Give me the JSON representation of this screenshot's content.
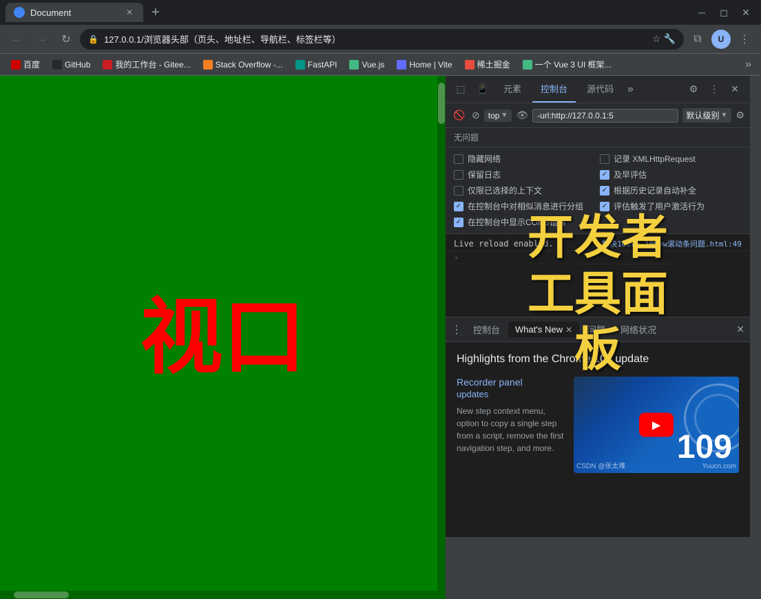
{
  "browser": {
    "tab": {
      "title": "Document",
      "favicon": "D"
    },
    "address": "127.0.0.1/浏览器头部（页头、地址栏、导航栏、标签栏等）",
    "title_annotation": "浏览器头部（页头、地址栏、导航栏、标签栏等）"
  },
  "bookmarks": [
    {
      "label": "百度",
      "icon": "bm-baidu"
    },
    {
      "label": "GitHub",
      "icon": "bm-github"
    },
    {
      "label": "我的工作台 - Gitee...",
      "icon": "bm-gitee"
    },
    {
      "label": "Stack Overflow -...",
      "icon": "bm-so"
    },
    {
      "label": "FastAPI",
      "icon": "bm-fastapi"
    },
    {
      "label": "Vue.js",
      "icon": "bm-vue"
    },
    {
      "label": "Home | Vite",
      "icon": "bm-vite"
    },
    {
      "label": "稀土掘金",
      "icon": "bm-siji"
    },
    {
      "label": "一个 Vue 3 UI 框架...",
      "icon": "bm-vue3"
    }
  ],
  "webpage": {
    "main_text": "视口"
  },
  "devtools": {
    "tabs": [
      "元素",
      "控制台",
      "源代码"
    ],
    "active_tab": "控制台",
    "context": "top",
    "filter_placeholder": "-url:http://127.0.0.1:5",
    "level": "默认级别",
    "issues_text": "无问题",
    "checkboxes": [
      {
        "label": "隐藏网络",
        "checked": false
      },
      {
        "label": "记录 XMLHttpRequest",
        "checked": false
      },
      {
        "label": "保留日志",
        "checked": false
      },
      {
        "label": "及早评估",
        "checked": true
      },
      {
        "label": "仅限已选择的上下文",
        "checked": false
      },
      {
        "label": "根据历史记录自动补全",
        "checked": true
      },
      {
        "label": "在控制台中对相似消息进行分组",
        "checked": true
      },
      {
        "label": "评估触发了用户激活行为",
        "checked": true
      },
      {
        "label": "在控制台中显示CORS错误",
        "checked": true
      }
    ],
    "console_log": "Live reload enabled.",
    "console_link": "解决100vh 100vw滚动条问题.html:49",
    "annotation_line1": "开发者",
    "annotation_line2": "工具面板",
    "bottom_tabs": [
      "控制台",
      "What's New",
      "问题",
      "网络状况"
    ],
    "active_bottom_tab": "What's New",
    "whats_new_title": "Highlights from the Chrome 109 update",
    "update_section_title": "Recorder panel",
    "update_section_subtitle": "updates",
    "update_desc": "New step context menu, option to copy a single step from a script, remove the first navigation step, and more.",
    "chrome_version": "109",
    "youtube_visible": true,
    "watermark": "Yuucn.com",
    "csdn_watermark": "CSDN @张太难"
  }
}
